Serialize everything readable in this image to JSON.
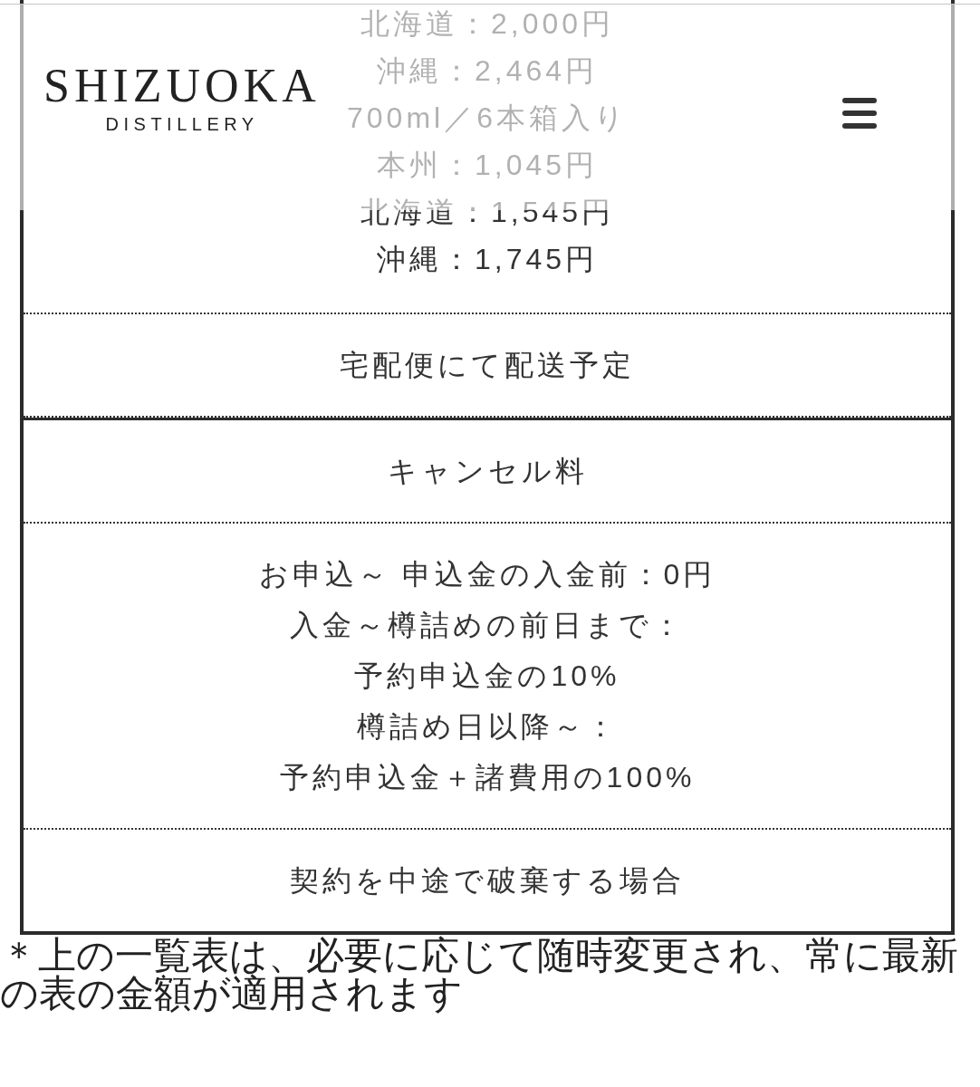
{
  "header": {
    "brand_name": "SHIZUOKA",
    "brand_subtitle": "DISTILLERY"
  },
  "table": {
    "rows": [
      {
        "cells": [
          {
            "lines": [
              "北海道：2,000円",
              "沖縄：2,464円",
              "700ml／6本箱入り",
              "本州：1,045円",
              "北海道：1,545円",
              "沖縄：1,745円"
            ]
          },
          {
            "lines": [
              "宅配便にて配送予定"
            ]
          }
        ]
      },
      {
        "cells": [
          {
            "lines": [
              "キャンセル料"
            ]
          },
          {
            "lines": [
              "お申込～ 申込金の入金前：0円",
              "入金～樽詰めの前日まで：",
              "予約申込金の10%",
              "樽詰め日以降～：",
              "予約申込金＋諸費用の100%"
            ]
          },
          {
            "lines": [
              "契約を中途で破棄する場合"
            ]
          }
        ]
      }
    ]
  },
  "footnote": "＊上の一覧表は、必要に応じて随時変更され、常に最新の表の金額が適用されます"
}
